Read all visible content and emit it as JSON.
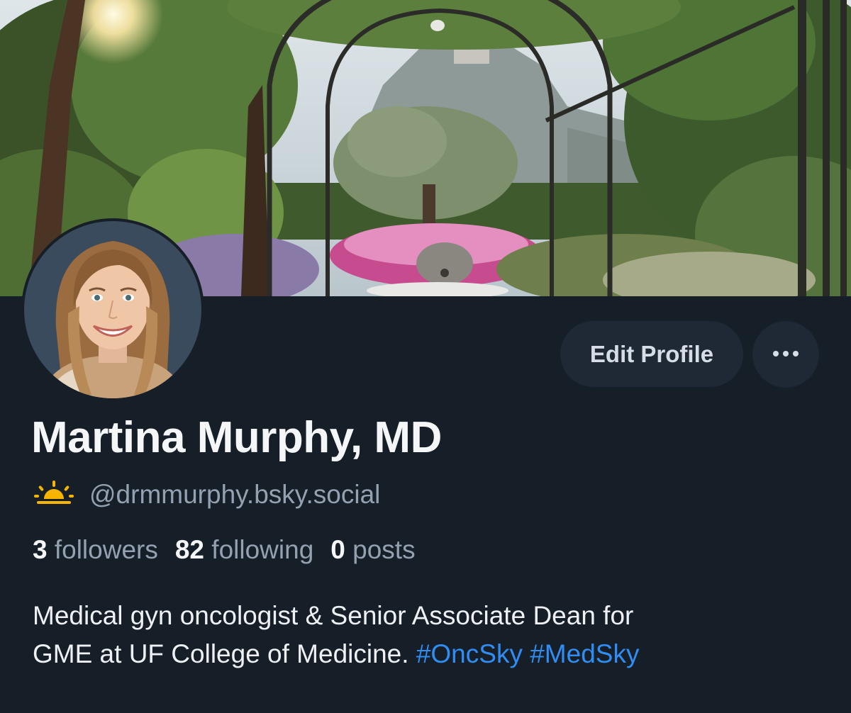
{
  "profile": {
    "display_name": "Martina Murphy, MD",
    "handle": "@drmmurphy.bsky.social",
    "handle_emoji_icon": "sunrise-icon",
    "stats": {
      "followers_count": "3",
      "followers_label": "followers",
      "following_count": "82",
      "following_label": "following",
      "posts_count": "0",
      "posts_label": "posts"
    },
    "bio_line1": "Medical gyn oncologist & Senior Associate Dean for",
    "bio_line2": "GME at UF College of Medicine.",
    "hashtags": [
      "#OncSky",
      "#MedSky"
    ]
  },
  "actions": {
    "edit_profile_label": "Edit Profile",
    "more_icon": "ellipsis-icon"
  },
  "colors": {
    "background": "#161e27",
    "button_bg": "#1e2935",
    "muted_text": "#93a1b1",
    "link": "#2f8df3",
    "emoji_yellow": "#f7b500"
  }
}
